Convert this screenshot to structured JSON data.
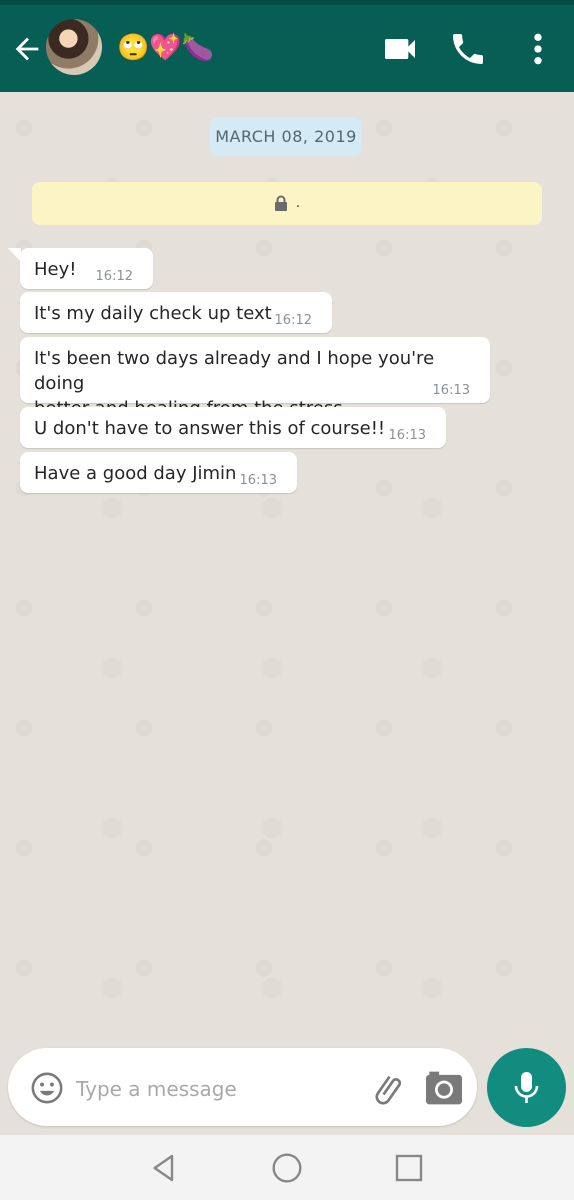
{
  "header": {
    "contact_name": "🙄💖🍆",
    "icons": {
      "back": "back-arrow-icon",
      "video": "video-call-icon",
      "call": "phone-icon",
      "menu": "more-vert-icon"
    },
    "colors": {
      "bar": "#075e54",
      "accent": "#128c7e"
    }
  },
  "chat": {
    "date_label": "MARCH 08, 2019",
    "encryption_notice": ".",
    "messages": [
      {
        "text": "Hey!",
        "time": "16:12"
      },
      {
        "text": "It's my daily check up text",
        "time": "16:12"
      },
      {
        "text": "It's been two days already and I hope you're doing\nbetter and healing from the stress",
        "time": "16:13"
      },
      {
        "text": "U don't have to answer this of course!!",
        "time": "16:13"
      },
      {
        "text": "Have a good day Jimin",
        "time": "16:13"
      }
    ]
  },
  "composer": {
    "placeholder": "Type a message",
    "icons": [
      "emoji-icon",
      "attach-icon",
      "camera-icon",
      "mic-icon"
    ]
  },
  "navbar": {
    "icons": [
      "nav-back-icon",
      "nav-home-icon",
      "nav-recents-icon"
    ]
  }
}
